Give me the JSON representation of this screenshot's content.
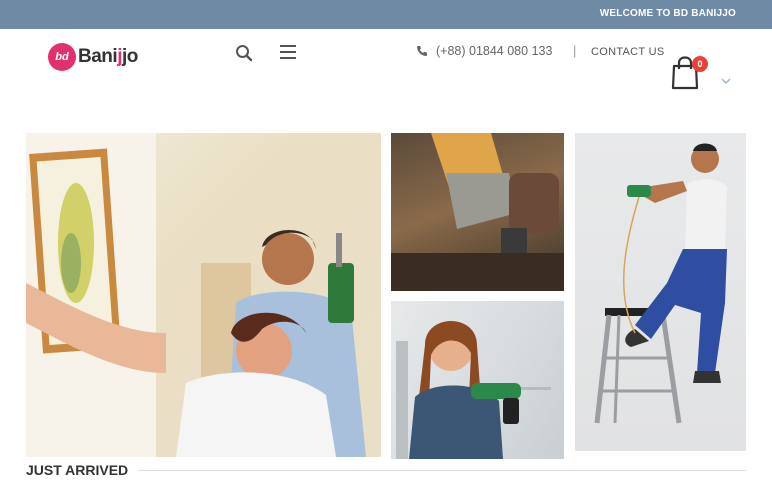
{
  "topbar": {
    "welcome": "WELCOME TO BD BANIJJO"
  },
  "header": {
    "logo_mark": "bd",
    "logo_word_1": "Bani",
    "logo_word_accent": "j",
    "logo_word_2": "jo",
    "phone": "(+88) 01844 080 133",
    "separator": "|",
    "contact_label": "CONTACT US",
    "cart_count": "0"
  },
  "icons": [
    "search-icon",
    "menu-icon",
    "phone-icon",
    "shopping-bag-icon",
    "chevron-down-icon"
  ],
  "colors": {
    "topbar": "#6f8aa5",
    "brand": "#e0306e",
    "badge": "#e8433a"
  },
  "section": {
    "title": "JUST ARRIVED"
  }
}
